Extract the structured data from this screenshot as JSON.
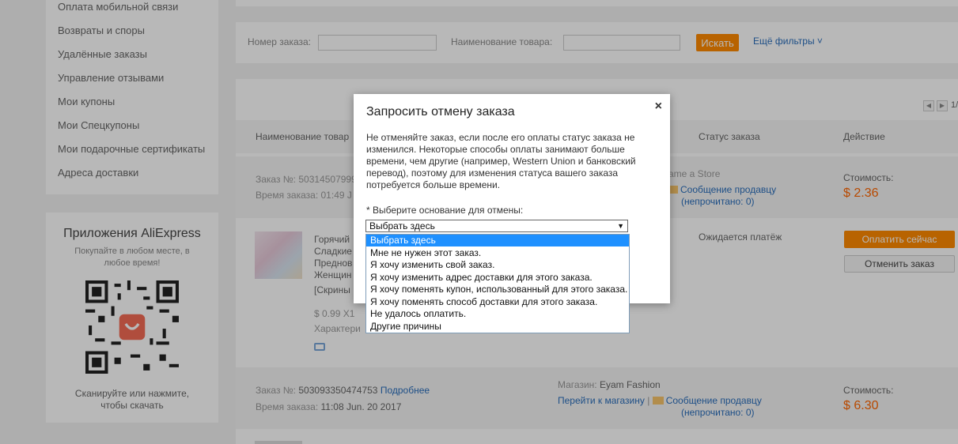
{
  "sidebar": {
    "items": [
      "Оплата мобильной связи",
      "Возвраты и споры",
      "Удалённые заказы",
      "Управление отзывами",
      "Мои купоны",
      "Мои Спецкупоны",
      "Мои подарочные сертификаты",
      "Адреса доставки"
    ],
    "app": {
      "title": "Приложения AliExpress",
      "subtitle": "Покупайте в любом месте, в любое время!",
      "caption": "Сканируйте или нажмите, чтобы скачать"
    }
  },
  "filters": {
    "order_number_label": "Номер заказа:",
    "product_name_label": "Наименование товара:",
    "search_button": "Искать",
    "more_filters": "Ещё фильтры ˅"
  },
  "pager": {
    "page_count": "1/"
  },
  "table": {
    "columns": [
      "Наименование товар",
      "Статус заказа",
      "Действие"
    ]
  },
  "orders": [
    {
      "number_label": "Заказ №: 50314507999",
      "time_label": "Время заказа: 01:49 J",
      "store": "ame a Store",
      "message_link": "Сообщение продавцу",
      "unread": "(непрочитано: 0)",
      "cost_label": "Стоимость:",
      "price": "$ 2.36",
      "product_lines": [
        "Горячий",
        "Сладкие",
        "Преднов",
        "Женщин",
        "[Скрины"
      ],
      "unit_price": "$ 0.99 X1",
      "characteristics": "Характери",
      "status": "Ожидается платёж",
      "pay_button": "Оплатить сейчас",
      "cancel_button": "Отменить заказ"
    },
    {
      "number_label": "Заказ №:",
      "number": "503093350474753",
      "details_link": "Подробнее",
      "time_label": "Время заказа:",
      "time": "11:08 Jun. 20 2017",
      "store_label": "Магазин:",
      "store": "Eyam Fashion",
      "go_to_store": "Перейти к магазину",
      "separator": "|",
      "message_link": "Сообщение продавцу",
      "unread": "(непрочитано: 0)",
      "cost_label": "Стоимость:",
      "price": "$ 6.30"
    }
  ],
  "modal": {
    "title": "Запросить отмену заказа",
    "close": "×",
    "text": "Не отменяйте заказ, если после его оплаты статус заказа не изменился. Некоторые способы оплаты занимают больше времени, чем другие (например, Western Union и банковский перевод), поэтому для изменения статуса вашего заказа потребуется больше времени.",
    "reason_label": "* Выберите основание для отмены:",
    "select_value": "Выбрать здесь",
    "select_arrow": "▼",
    "options": [
      "Выбрать здесь",
      "Мне не нужен этот заказ.",
      "Я хочу изменить свой заказ.",
      "Я хочу изменить адрес доставки для этого заказа.",
      "Я хочу поменять купон, использованный для этого заказа.",
      "Я хочу поменять способ доставки для этого заказа.",
      "Не удалось оплатить.",
      "Другие причины"
    ]
  },
  "colors": {
    "accent": "#ff8a00",
    "price": "#ff6600",
    "link": "#2a6ebb",
    "selection": "#1e90ff"
  }
}
